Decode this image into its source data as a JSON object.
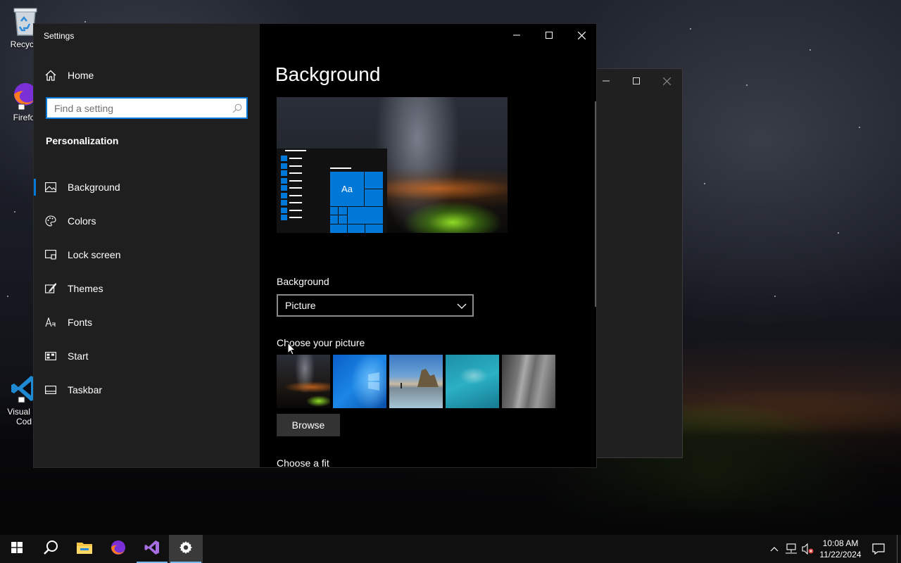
{
  "desktop": {
    "icons": [
      {
        "label": "Recycle",
        "icon": "recycle-bin-icon"
      },
      {
        "label": "Firefo",
        "icon": "firefox-icon"
      },
      {
        "label": "Visual St\nCod",
        "icon": "vscode-icon"
      }
    ]
  },
  "settings": {
    "window_title": "Settings",
    "home_label": "Home",
    "search_placeholder": "Find a setting",
    "section_title": "Personalization",
    "nav": [
      {
        "label": "Background",
        "icon": "picture-icon",
        "active": true
      },
      {
        "label": "Colors",
        "icon": "palette-icon",
        "active": false
      },
      {
        "label": "Lock screen",
        "icon": "lock-screen-icon",
        "active": false
      },
      {
        "label": "Themes",
        "icon": "brush-icon",
        "active": false
      },
      {
        "label": "Fonts",
        "icon": "font-icon",
        "active": false
      },
      {
        "label": "Start",
        "icon": "start-icon",
        "active": false
      },
      {
        "label": "Taskbar",
        "icon": "taskbar-icon",
        "active": false
      }
    ],
    "page_title": "Background",
    "preview_tile_text": "Aa",
    "background_label": "Background",
    "background_value": "Picture",
    "choose_picture_label": "Choose your picture",
    "browse_label": "Browse",
    "choose_fit_label": "Choose a fit"
  },
  "taskbar": {
    "apps": [
      "start-icon",
      "search-icon",
      "file-explorer-icon",
      "firefox-icon",
      "vscode-icon",
      "settings-icon"
    ],
    "time": "10:08 AM",
    "date": "11/22/2024"
  },
  "colors": {
    "accent": "#0078d7",
    "sidebar_bg": "#1f1f1f",
    "content_bg": "#000000",
    "taskbar_bg": "#101010"
  }
}
